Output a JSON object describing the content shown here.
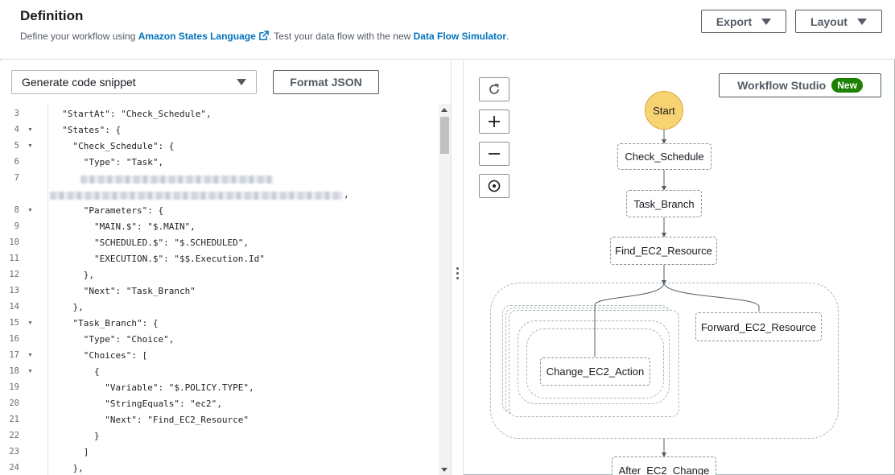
{
  "header": {
    "title": "Definition",
    "subtitle_prefix": "Define your workflow using ",
    "asl_link": "Amazon States Language",
    "subtitle_middle": ". Test your data flow with the new ",
    "dfs_link": "Data Flow Simulator",
    "subtitle_suffix": ".",
    "export_label": "Export",
    "layout_label": "Layout"
  },
  "editor": {
    "snippet_select": "Generate code snippet",
    "format_label": "Format JSON",
    "lines": [
      {
        "n": "3",
        "fold": false,
        "text": "  \"StartAt\": \"Check_Schedule\","
      },
      {
        "n": "4",
        "fold": true,
        "text": "  \"States\": {"
      },
      {
        "n": "5",
        "fold": true,
        "text": "    \"Check_Schedule\": {"
      },
      {
        "n": "6",
        "fold": false,
        "text": "      \"Type\": \"Task\","
      },
      {
        "n": "7",
        "fold": false,
        "text": ""
      },
      {
        "n": "",
        "fold": false,
        "text": ""
      },
      {
        "n": "8",
        "fold": true,
        "text": "      \"Parameters\": {"
      },
      {
        "n": "9",
        "fold": false,
        "text": "        \"MAIN.$\": \"$.MAIN\","
      },
      {
        "n": "10",
        "fold": false,
        "text": "        \"SCHEDULED.$\": \"$.SCHEDULED\","
      },
      {
        "n": "11",
        "fold": false,
        "text": "        \"EXECUTION.$\": \"$$.Execution.Id\""
      },
      {
        "n": "12",
        "fold": false,
        "text": "      },"
      },
      {
        "n": "13",
        "fold": false,
        "text": "      \"Next\": \"Task_Branch\""
      },
      {
        "n": "14",
        "fold": false,
        "text": "    },"
      },
      {
        "n": "15",
        "fold": true,
        "text": "    \"Task_Branch\": {"
      },
      {
        "n": "16",
        "fold": false,
        "text": "      \"Type\": \"Choice\","
      },
      {
        "n": "17",
        "fold": true,
        "text": "      \"Choices\": ["
      },
      {
        "n": "18",
        "fold": true,
        "text": "        {"
      },
      {
        "n": "19",
        "fold": false,
        "text": "          \"Variable\": \"$.POLICY.TYPE\","
      },
      {
        "n": "20",
        "fold": false,
        "text": "          \"StringEquals\": \"ec2\","
      },
      {
        "n": "21",
        "fold": false,
        "text": "          \"Next\": \"Find_EC2_Resource\""
      },
      {
        "n": "22",
        "fold": false,
        "text": "        }"
      },
      {
        "n": "23",
        "fold": false,
        "text": "      ]"
      },
      {
        "n": "24",
        "fold": false,
        "text": "    },"
      }
    ],
    "line8_tail": ","
  },
  "graph": {
    "workflow_studio_label": "Workflow Studio",
    "new_badge": "New",
    "nodes": {
      "start": "Start",
      "check_schedule": "Check_Schedule",
      "task_branch": "Task_Branch",
      "find_ec2": "Find_EC2_Resource",
      "forward_ec2": "Forward_EC2_Resource",
      "change_ec2": "Change_EC2_Action",
      "after_ec2": "After_EC2_Change"
    },
    "controls": [
      "refresh-icon",
      "zoom-in-icon",
      "zoom-out-icon",
      "center-icon"
    ]
  }
}
